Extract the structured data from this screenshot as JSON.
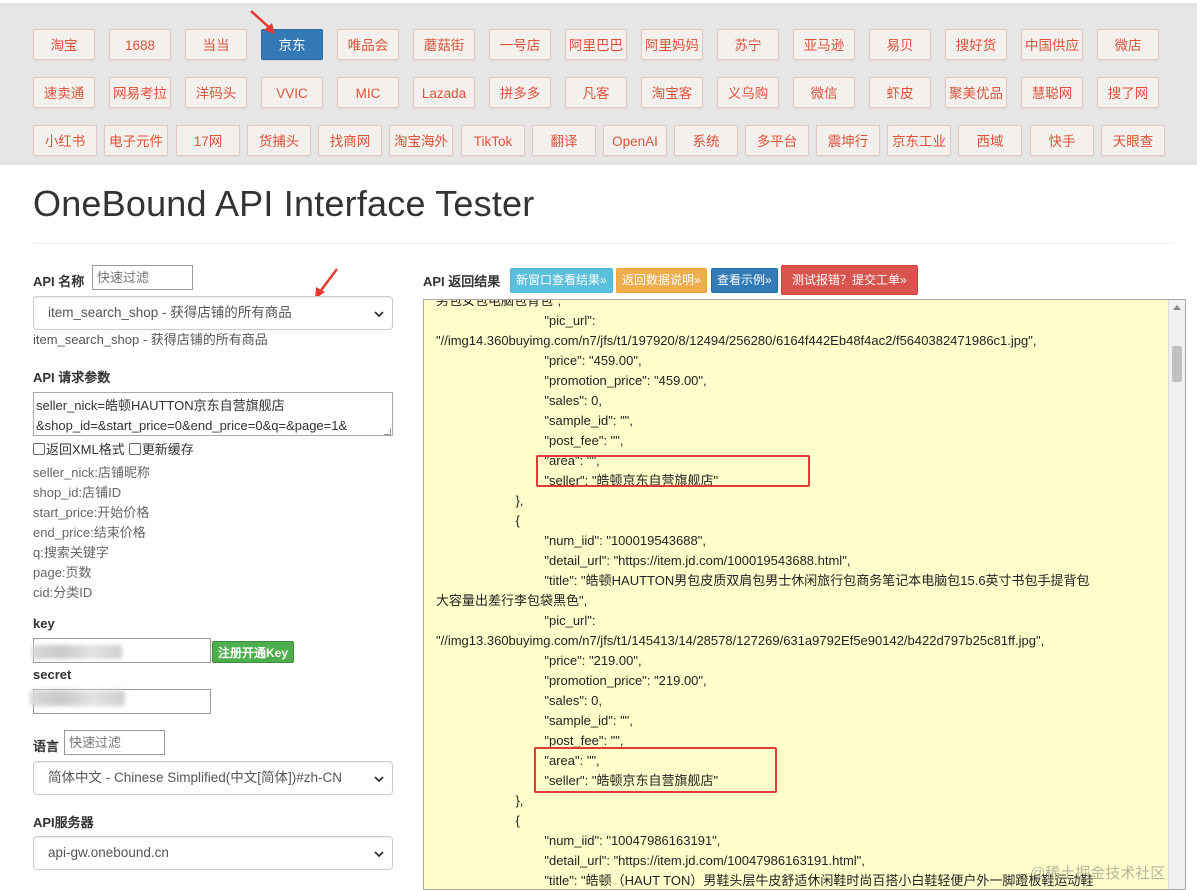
{
  "platforms": {
    "row1": [
      "淘宝",
      "1688",
      "当当",
      "京东",
      "唯品会",
      "蘑菇街",
      "一号店",
      "阿里巴巴",
      "阿里妈妈",
      "苏宁",
      "亚马逊",
      "易贝",
      "搜好货",
      "中国供应",
      "微店"
    ],
    "row2": [
      "速卖通",
      "网易考拉",
      "洋码头",
      "VVIC",
      "MIC",
      "Lazada",
      "拼多多",
      "凡客",
      "淘宝客",
      "义乌购",
      "微信",
      "虾皮",
      "聚美优品",
      "慧聪网",
      "搜了网"
    ],
    "row3": [
      "小红书",
      "电子元件",
      "17网",
      "货捕头",
      "找商网",
      "淘宝海外",
      "TikTok",
      "翻译",
      "OpenAI",
      "系统",
      "多平台",
      "震坤行",
      "京东工业",
      "西域",
      "快手",
      "天眼查"
    ],
    "active": "京东",
    "active_color": "#337ab7",
    "button_text_color": "#e0533a"
  },
  "page_title": "OneBound API Interface Tester",
  "form": {
    "api_name_label": "API 名称",
    "filter_placeholder": "快速过滤",
    "api_selected": "item_search_shop - 获得店铺的所有商品",
    "api_desc": "item_search_shop - 获得店铺的所有商品",
    "params_label": "API 请求参数",
    "params_line1": "seller_nick=皓顿HAUTTON京东自营旗舰店",
    "params_line2": "&shop_id=&start_price=0&end_price=0&q=&page=1&",
    "xml_checkbox": "返回XML格式",
    "cache_checkbox": "更新缓存",
    "param_help": [
      "seller_nick:店铺昵称",
      "shop_id:店铺ID",
      "start_price:开始价格",
      "end_price:结束价格",
      "q:搜索关键字",
      "page:页数",
      "cid:分类ID"
    ],
    "key_label": "key",
    "register_button": "注册开通Key",
    "secret_label": "secret",
    "lang_label": "语言",
    "lang_selected": "简体中文 - Chinese Simplified(中文[简体])#zh-CN",
    "server_label": "API服务器",
    "server_selected": "api-gw.onebound.cn"
  },
  "result": {
    "label": "API 返回结果",
    "buttons": {
      "new_window": "新窗口查看结果»",
      "data_desc": "返回数据说明»",
      "examples": "查看示例»",
      "report": "测试报错？提交工单»"
    },
    "lines": [
      "男包女包电脑包背包\",",
      "                              \"pic_url\":",
      "\"//img14.360buyimg.com/n7/jfs/t1/197920/8/12494/256280/6164f442Eb48f4ac2/f5640382471986c1.jpg\",",
      "                              \"price\": \"459.00\",",
      "                              \"promotion_price\": \"459.00\",",
      "                              \"sales\": 0,",
      "                              \"sample_id\": \"\",",
      "                              \"post_fee\": \"\",",
      "                              \"area\": \"\",",
      "                              \"seller\": \"皓顿京东自营旗舰店\"",
      "                      },",
      "                      {",
      "                              \"num_iid\": \"100019543688\",",
      "                              \"detail_url\": \"https://item.jd.com/100019543688.html\",",
      "                              \"title\": \"皓顿HAUTTON男包皮质双肩包男士休闲旅行包商务笔记本电脑包15.6英寸书包手提背包",
      "大容量出差行李包袋黑色\",",
      "                              \"pic_url\":",
      "\"//img13.360buyimg.com/n7/jfs/t1/145413/14/28578/127269/631a9792Ef5e90142/b422d797b25c81ff.jpg\",",
      "                              \"price\": \"219.00\",",
      "                              \"promotion_price\": \"219.00\",",
      "                              \"sales\": 0,",
      "                              \"sample_id\": \"\",",
      "                              \"post_fee\": \"\",",
      "                              \"area\": \"\",",
      "                              \"seller\": \"皓顿京东自营旗舰店\"",
      "                      },",
      "                      {",
      "                              \"num_iid\": \"10047986163191\",",
      "                              \"detail_url\": \"https://item.jd.com/10047986163191.html\",",
      "                              \"title\": \"皓顿（HAUT TON）男鞋头层牛皮舒适休闲鞋时尚百搭小白鞋轻便户外一脚蹬板鞋运动鞋"
    ]
  },
  "watermark": "@稀土掘金技术社区",
  "colors": {
    "highlight": "#e53935",
    "result_bg": "#ffffcc",
    "green": "#4cae4c"
  }
}
